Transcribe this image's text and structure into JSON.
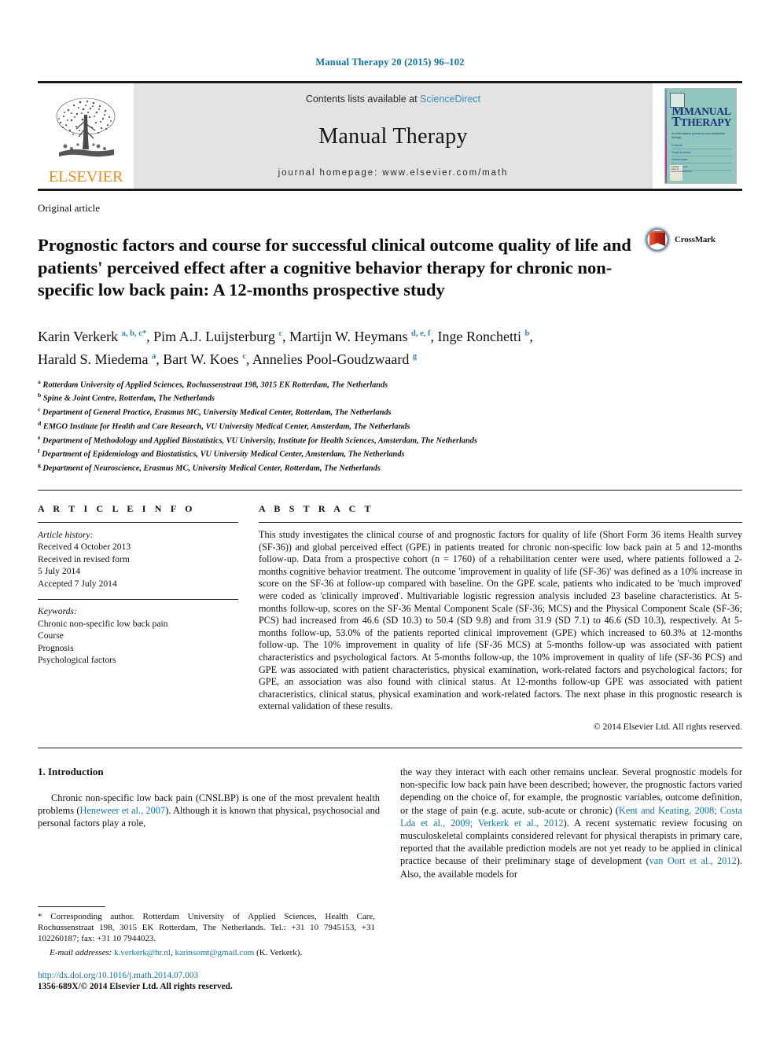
{
  "running_head": "Manual Therapy 20 (2015) 96–102",
  "masthead": {
    "contents_prefix": "Contents lists available at ",
    "sciencedirect": "ScienceDirect",
    "journal_name": "Manual Therapy",
    "journal_homepage": "journal homepage: www.elsevier.com/math",
    "publisher": "ELSEVIER",
    "cover": {
      "title_line1": "MANUAL",
      "title_line2": "THERAPY",
      "subtitle": "An international journal of\nmusculoskeletal therapy",
      "lines": [
        "Editorial",
        "Original article",
        "Masterclass",
        "Case report"
      ],
      "foot": "Available online at\nwww.sciencedirect.com"
    }
  },
  "article": {
    "type": "Original article",
    "title": "Prognostic factors and course for successful clinical outcome quality of life and patients' perceived effect after a cognitive behavior therapy for chronic non-specific low back pain: A 12-months prospective study",
    "crossmark_label": "CrossMark",
    "authors": [
      {
        "name": "Karin Verkerk",
        "sup": "a, b, c",
        "star": "*"
      },
      {
        "name": "Pim A.J. Luijsterburg",
        "sup": "c"
      },
      {
        "name": "Martijn W. Heymans",
        "sup": "d, e, f"
      },
      {
        "name": "Inge Ronchetti",
        "sup": "b"
      },
      {
        "name": "Harald S. Miedema",
        "sup": "a"
      },
      {
        "name": "Bart W. Koes",
        "sup": "c"
      },
      {
        "name": "Annelies Pool-Goudzwaard",
        "sup": "g"
      }
    ],
    "affiliations": [
      {
        "key": "a",
        "text": "Rotterdam University of Applied Sciences, Rochussenstraat 198, 3015 EK Rotterdam, The Netherlands"
      },
      {
        "key": "b",
        "text": "Spine & Joint Centre, Rotterdam, The Netherlands"
      },
      {
        "key": "c",
        "text": "Department of General Practice, Erasmus MC, University Medical Center, Rotterdam, The Netherlands"
      },
      {
        "key": "d",
        "text": "EMGO Institute for Health and Care Research, VU University Medical Center, Amsterdam, The Netherlands"
      },
      {
        "key": "e",
        "text": "Department of Methodology and Applied Biostatistics, VU University, Institute for Health Sciences, Amsterdam, The Netherlands"
      },
      {
        "key": "f",
        "text": "Department of Epidemiology and Biostatistics, VU University Medical Center, Amsterdam, The Netherlands"
      },
      {
        "key": "g",
        "text": "Department of Neuroscience, Erasmus MC, University Medical Center, Rotterdam, The Netherlands"
      }
    ]
  },
  "article_info": {
    "heading": "A R T I C L E  I N F O",
    "history_label": "Article history:",
    "history": [
      "Received 4 October 2013",
      "Received in revised form",
      "5 July 2014",
      "Accepted 7 July 2014"
    ],
    "keywords_label": "Keywords:",
    "keywords": [
      "Chronic non-specific low back pain",
      "Course",
      "Prognosis",
      "Psychological factors"
    ]
  },
  "abstract": {
    "heading": "A B S T R A C T",
    "text": "This study investigates the clinical course of and prognostic factors for quality of life (Short Form 36 items Health survey (SF-36)) and global perceived effect (GPE) in patients treated for chronic non-specific low back pain at 5 and 12-months follow-up. Data from a prospective cohort (n = 1760) of a rehabilitation center were used, where patients followed a 2-months cognitive behavior treatment. The outcome 'improvement in quality of life (SF-36)' was defined as a 10% increase in score on the SF-36 at follow-up compared with baseline. On the GPE scale, patients who indicated to be 'much improved' were coded as 'clinically improved'. Multivariable logistic regression analysis included 23 baseline characteristics. At 5-months follow-up, scores on the SF-36 Mental Component Scale (SF-36; MCS) and the Physical Component Scale (SF-36; PCS) had increased from 46.6 (SD 10.3) to 50.4 (SD 9.8) and from 31.9 (SD 7.1) to 46.6 (SD 10.3), respectively. At 5-months follow-up, 53.0% of the patients reported clinical improvement (GPE) which increased to 60.3% at 12-months follow-up. The 10% improvement in quality of life (SF-36 MCS) at 5-months follow-up was associated with patient characteristics and psychological factors. At 5-months follow-up, the 10% improvement in quality of life (SF-36 PCS) and GPE was associated with patient characteristics, physical examination, work-related factors and psychological factors; for GPE, an association was also found with clinical status. At 12-months follow-up GPE was associated with patient characteristics, clinical status, physical examination and work-related factors. The next phase in this prognostic research is external validation of these results.",
    "copyright": "© 2014 Elsevier Ltd. All rights reserved."
  },
  "introduction": {
    "heading": "1. Introduction",
    "left_para_1": "Chronic non-specific low back pain (CNSLBP) is one of the most prevalent health problems (",
    "left_ref_1": "Heneweer et al., 2007",
    "left_para_2": "). Although it is known that physical, psychosocial and personal factors play a role,",
    "right_para_1": "the way they interact with each other remains unclear. Several prognostic models for non-specific low back pain have been described; however, the prognostic factors varied depending on the choice of, for example, the prognostic variables, outcome definition, or the stage of pain (e.g. acute, sub-acute or chronic) (",
    "right_ref_1": "Kent and Keating, 2008; Costa Lda et al., 2009; Verkerk et al., 2012",
    "right_para_2": "). A recent systematic review focusing on musculoskeletal complaints considered relevant for physical therapists in primary care, reported that the available prediction models are not yet ready to be applied in clinical practice because of their preliminary stage of development (",
    "right_ref_2": "van Oort et al., 2012",
    "right_para_3": "). Also, the available models for"
  },
  "footnote": {
    "star": "*",
    "corresponding": " Corresponding author. Rotterdam University of Applied Sciences, Health Care, Rochussenstraat 198, 3015 EK Rotterdam, The Netherlands. Tel.: +31 10 7945153, +31 102260187; fax: +31 10 7944023.",
    "email_label": "E-mail addresses:",
    "email_1": "k.verkerk@hr.nl",
    "email_2": "karinsomt@gmail.com",
    "email_suffix": " (K. Verkerk).",
    "doi": "http://dx.doi.org/10.1016/j.math.2014.07.003",
    "issn": "1356-689X/© 2014 Elsevier Ltd. All rights reserved."
  },
  "colors": {
    "link": "#1277ad",
    "running_head": "#0d72a8",
    "elsevier_orange": "#ec8e24",
    "sciencedirect": "#3c8fc4",
    "cover_bg": "#8fc6bd"
  }
}
